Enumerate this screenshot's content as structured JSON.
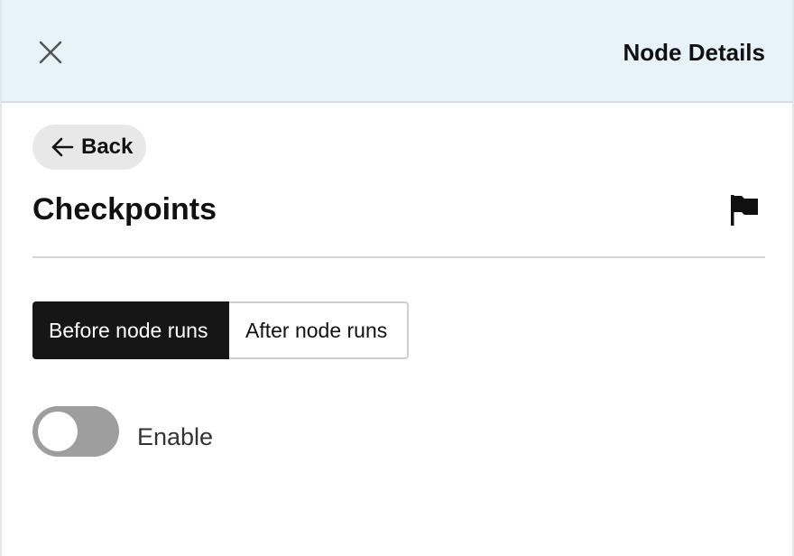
{
  "header": {
    "title": "Node Details",
    "close_icon": "close-icon"
  },
  "back": {
    "label": "Back",
    "icon": "arrow-left-icon"
  },
  "section": {
    "title": "Checkpoints",
    "icon": "flag-icon"
  },
  "segments": {
    "items": [
      {
        "label": "Before node runs",
        "active": true
      },
      {
        "label": "After node runs",
        "active": false
      }
    ]
  },
  "toggle": {
    "label": "Enable",
    "on": false
  },
  "colors": {
    "header_bg": "#e8f2f9",
    "active_segment": "#161616",
    "toggle_off": "#9e9e9e"
  }
}
